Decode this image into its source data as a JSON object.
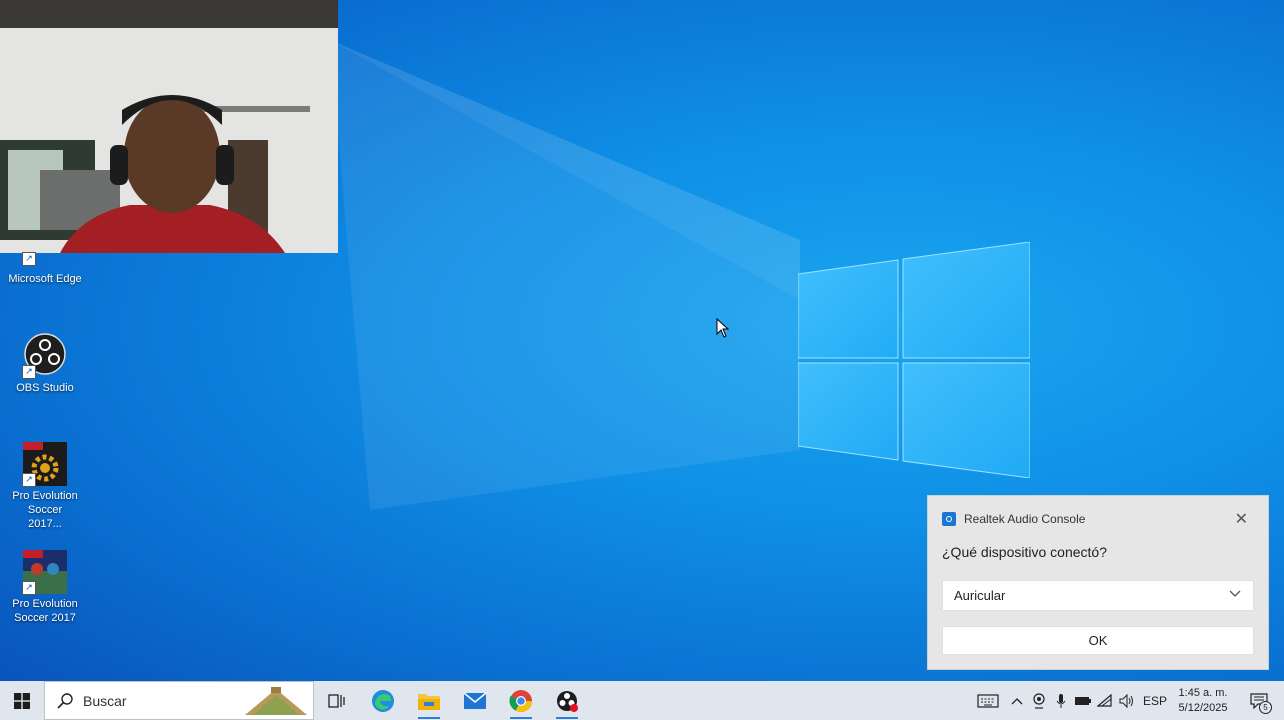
{
  "desktop": {
    "icons": [
      {
        "label": "Microsoft Edge",
        "icon": "edge-icon"
      },
      {
        "label": "OBS Studio",
        "icon": "obs-icon"
      },
      {
        "label": "Pro Evolution Soccer 2017...",
        "icon": "pes-settings-icon"
      },
      {
        "label": "Pro Evolution Soccer 2017",
        "icon": "pes-game-icon"
      }
    ]
  },
  "webcam_overlay": {
    "description_icon": "webcam-feed"
  },
  "notification": {
    "app_name": "Realtek Audio Console",
    "question": "¿Qué dispositivo conectó?",
    "selected_device": "Auricular",
    "ok_label": "OK",
    "close_glyph": "✕"
  },
  "taskbar": {
    "search_placeholder": "Buscar",
    "apps": [
      "task-view-icon",
      "edge-icon",
      "file-explorer-icon",
      "mail-icon",
      "chrome-icon",
      "obs-icon"
    ],
    "tray": {
      "language": "ESP",
      "time": "1:45 a. m.",
      "date": "5/12/2025",
      "notification_count": "5"
    }
  },
  "colors": {
    "accent": "#2b7de1",
    "desktop": "#0f8fe6",
    "taskbar": "#dfe6ee"
  }
}
